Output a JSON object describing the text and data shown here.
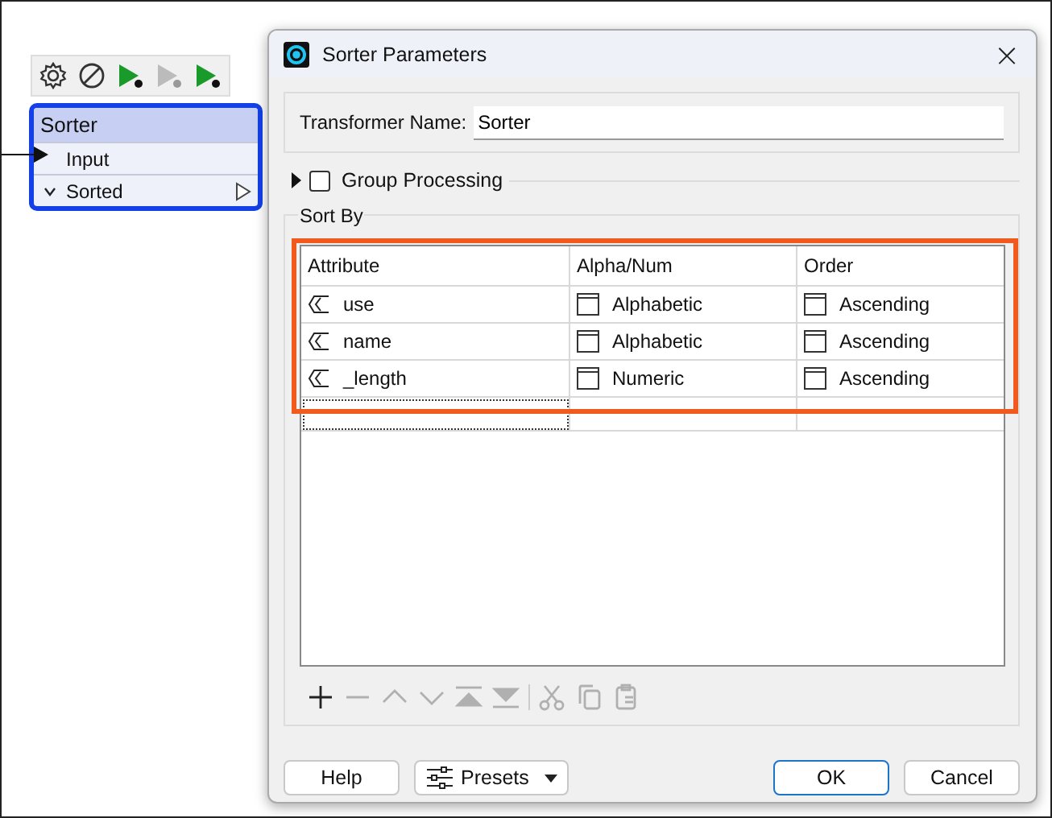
{
  "canvas": {
    "toolbar": [
      {
        "kind": "gear",
        "disabled": false
      },
      {
        "kind": "prohibit",
        "disabled": false
      },
      {
        "kind": "run-to",
        "disabled": false
      },
      {
        "kind": "run",
        "disabled": true
      },
      {
        "kind": "run-from",
        "disabled": false
      }
    ],
    "node": {
      "title": "Sorter",
      "selected": true,
      "input": "Input",
      "output": "Sorted",
      "output_expanded": true
    }
  },
  "dialog": {
    "title": "Sorter Parameters",
    "close": "×",
    "transformer_name": {
      "label": "Transformer Name:",
      "value": "Sorter"
    },
    "group_processing": {
      "label": "Group Processing",
      "expanded": false,
      "checked": false
    },
    "sort_by": {
      "title": "Sort By",
      "highlighted": true,
      "columns": [
        "Attribute",
        "Alpha/Num",
        "Order"
      ],
      "rows": [
        {
          "attribute": "use",
          "alpha_num": "Alphabetic",
          "order": "Ascending"
        },
        {
          "attribute": "name",
          "alpha_num": "Alphabetic",
          "order": "Ascending"
        },
        {
          "attribute": "_length",
          "alpha_num": "Numeric",
          "order": "Ascending"
        }
      ],
      "toolbar": [
        {
          "kind": "add",
          "disabled": false
        },
        {
          "kind": "remove",
          "disabled": true
        },
        {
          "kind": "up",
          "disabled": true
        },
        {
          "kind": "down",
          "disabled": true
        },
        {
          "kind": "top",
          "disabled": true
        },
        {
          "kind": "bottom",
          "disabled": true
        },
        {
          "kind": "sep"
        },
        {
          "kind": "cut",
          "disabled": true
        },
        {
          "kind": "copy",
          "disabled": true
        },
        {
          "kind": "paste",
          "disabled": true
        }
      ]
    },
    "buttons": [
      {
        "label": "Help",
        "kind": "plain"
      },
      {
        "label": "Presets",
        "kind": "menu"
      },
      {
        "label": "OK",
        "kind": "default"
      },
      {
        "label": "Cancel",
        "kind": "plain"
      }
    ]
  }
}
